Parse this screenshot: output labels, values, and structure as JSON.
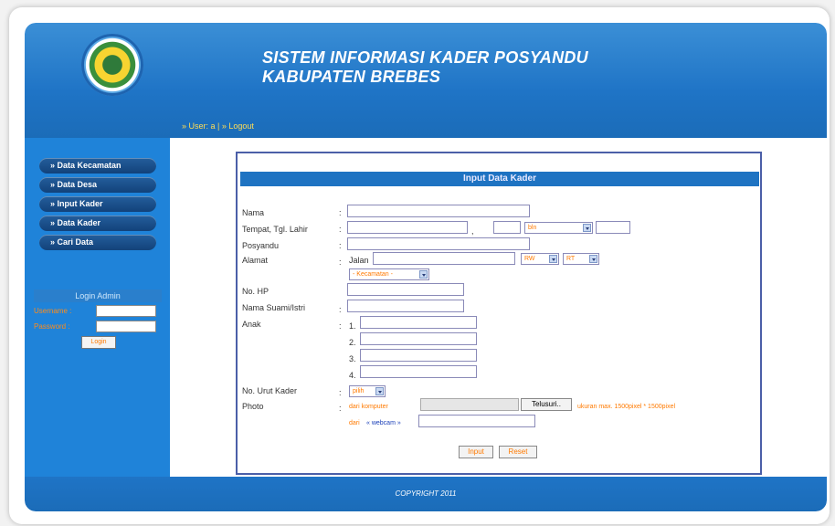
{
  "header": {
    "title_line1": "SISTEM INFORMASI KADER POSYANDU",
    "title_line2": "KABUPATEN BREBES",
    "user_label": "» User: a",
    "separator": " | ",
    "logout": "» Logout"
  },
  "sidebar": {
    "menu": [
      {
        "label": "» Data Kecamatan"
      },
      {
        "label": "» Data Desa"
      },
      {
        "label": "» Input Kader"
      },
      {
        "label": "» Data Kader"
      },
      {
        "label": "» Cari Data"
      }
    ],
    "login": {
      "title": "Login Admin",
      "username_label": "Username :",
      "password_label": "Password :",
      "button": "Login"
    }
  },
  "form": {
    "title": "Input Data Kader",
    "labels": {
      "nama": "Nama",
      "ttl": "Tempat, Tgl. Lahir",
      "posyandu": "Posyandu",
      "alamat": "Alamat",
      "hp": "No. HP",
      "suami": "Nama Suami/Istri",
      "anak": "Anak",
      "urut": "No. Urut Kader",
      "photo": "Photo"
    },
    "colon": ":",
    "comma": ",",
    "jalan": "Jalan",
    "bln_select": "bln",
    "rw_select": "RW",
    "rt_select": "RT",
    "kecamatan_select": "- Kecamatan -",
    "anak_numbers": [
      "1.",
      "2.",
      "3.",
      "4."
    ],
    "urut_select": "pilih",
    "dari_komputer": "dari komputer",
    "browse_button": "Telusuri..",
    "size_note": "ukuran max. 1500pixel * 1500pixel",
    "dari_webcam_prefix": "dari",
    "webcam_link": "« webcam »",
    "input_button": "Input",
    "reset_button": "Reset"
  },
  "footer": {
    "copyright": "COPYRIGHT 2011"
  }
}
